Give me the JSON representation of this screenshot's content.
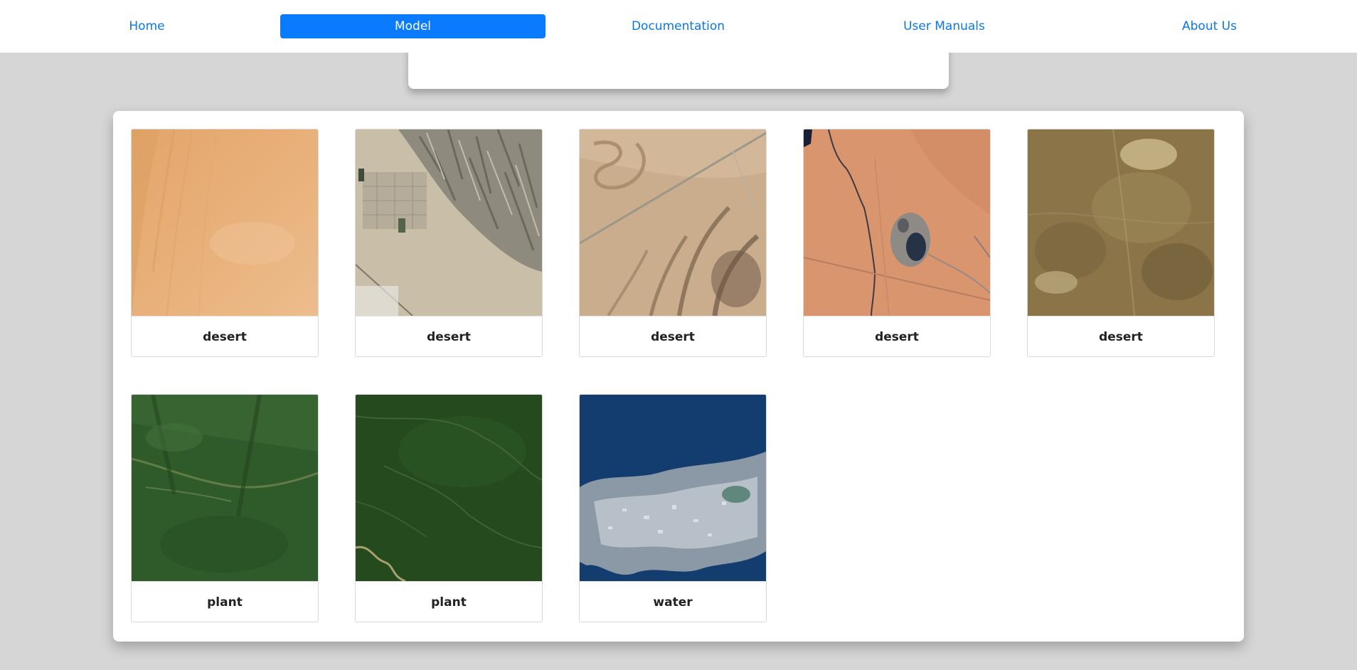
{
  "nav": {
    "items": [
      {
        "label": "Home",
        "active": false
      },
      {
        "label": "Model",
        "active": true
      },
      {
        "label": "Documentation",
        "active": false
      },
      {
        "label": "User Manuals",
        "active": false
      },
      {
        "label": "About Us",
        "active": false
      }
    ]
  },
  "colors": {
    "accent": "#0a7bff",
    "link": "#0a78e6",
    "background": "#d6d6d6"
  },
  "gallery": {
    "cards": [
      {
        "label": "desert",
        "image": "sand-dunes-satellite"
      },
      {
        "label": "desert",
        "image": "arid-city-mountains-satellite"
      },
      {
        "label": "desert",
        "image": "dry-riverbeds-highway-satellite"
      },
      {
        "label": "desert",
        "image": "red-desert-mine-satellite"
      },
      {
        "label": "desert",
        "image": "brown-scrubland-satellite"
      },
      {
        "label": "plant",
        "image": "forest-mountains-satellite"
      },
      {
        "label": "plant",
        "image": "dense-forest-river-satellite"
      },
      {
        "label": "water",
        "image": "coastal-city-sea-satellite"
      }
    ]
  }
}
